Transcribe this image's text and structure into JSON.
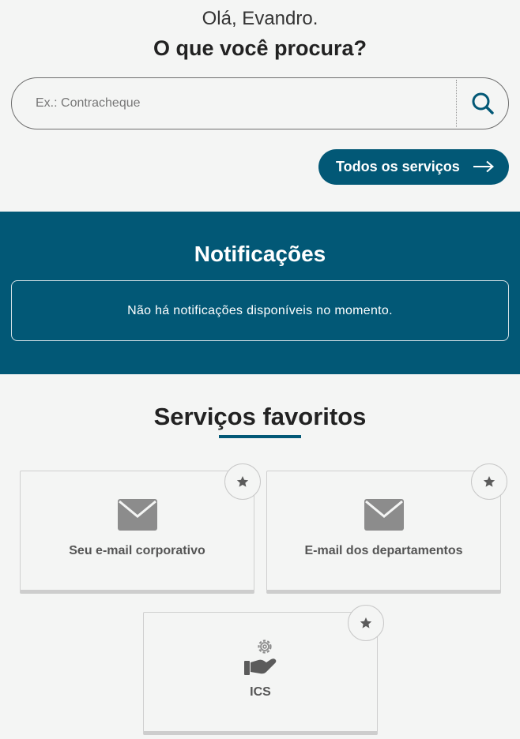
{
  "header": {
    "greeting": "Olá, Evandro.",
    "question": "O que você procura?"
  },
  "search": {
    "placeholder": "Ex.: Contracheque",
    "value": "",
    "icon": "search-icon"
  },
  "all_services": {
    "label": "Todos os serviços",
    "icon": "arrow-right-icon"
  },
  "notifications": {
    "title": "Notificações",
    "empty_message": "Não há notificações disponíveis no momento."
  },
  "favorites": {
    "title": "Serviços favoritos",
    "items": [
      {
        "label": "Seu e-mail corporativo",
        "icon": "envelope-icon"
      },
      {
        "label": "E-mail dos departamentos",
        "icon": "envelope-icon"
      },
      {
        "label": "ICS",
        "icon": "hand-gear-icon"
      }
    ]
  },
  "colors": {
    "primary": "#025876",
    "background": "#f4f5f4",
    "icon_gray": "#8c8c8c",
    "star_gray": "#5b5b5b"
  }
}
